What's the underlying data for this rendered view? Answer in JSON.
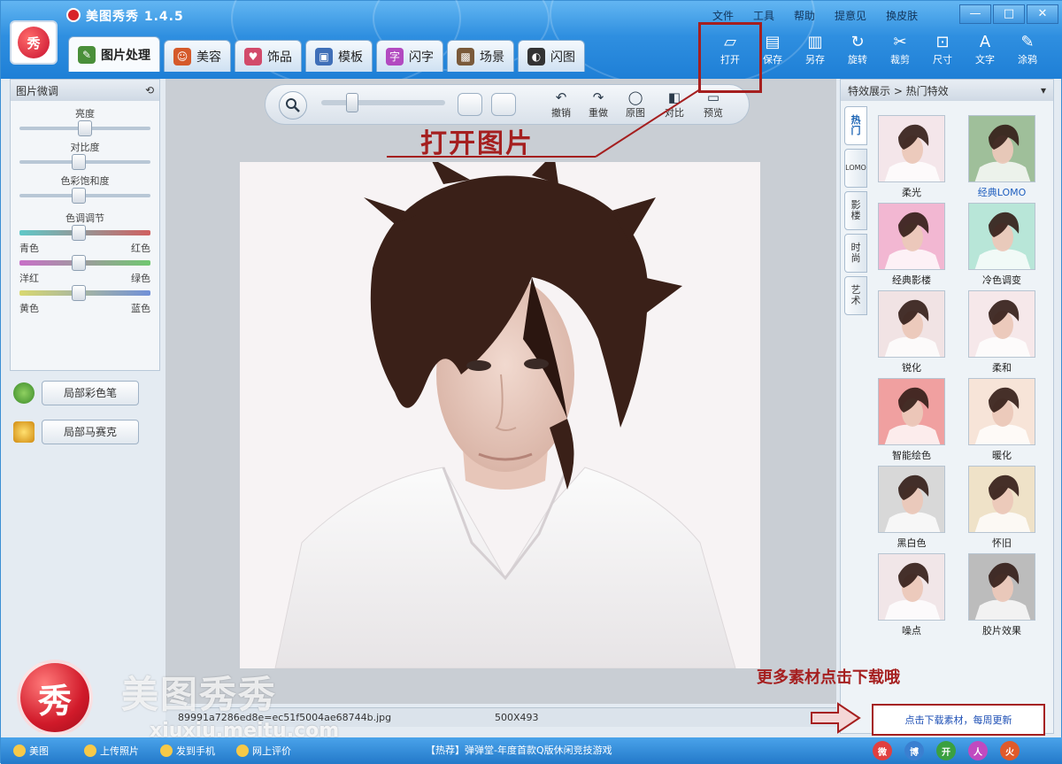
{
  "app": {
    "title": "美图秀秀 1.4.5",
    "logo_text": "秀"
  },
  "menu": [
    "文件",
    "工具",
    "帮助",
    "提意见",
    "换皮肤"
  ],
  "window_controls": [
    "—",
    "□",
    "✕"
  ],
  "tabs": [
    {
      "label": "图片处理",
      "icon": "image-edit-icon",
      "color": "#4a8f3a"
    },
    {
      "label": "美容",
      "icon": "face-icon",
      "color": "#d55a2a"
    },
    {
      "label": "饰品",
      "icon": "accessory-icon",
      "color": "#d24a6a"
    },
    {
      "label": "模板",
      "icon": "template-icon",
      "color": "#3f6fb8"
    },
    {
      "label": "闪字",
      "icon": "text-icon",
      "color": "#b24ac0"
    },
    {
      "label": "场景",
      "icon": "scene-icon",
      "color": "#7a5a3a"
    },
    {
      "label": "闪图",
      "icon": "flash-image-icon",
      "color": "#333333"
    }
  ],
  "tools": [
    {
      "label": "打开",
      "icon": "folder-open-icon",
      "glyph": "📂"
    },
    {
      "label": "保存",
      "icon": "save-icon",
      "glyph": "▤"
    },
    {
      "label": "另存",
      "icon": "save-as-icon",
      "glyph": "▥"
    },
    {
      "label": "旋转",
      "icon": "rotate-icon",
      "glyph": "↻"
    },
    {
      "label": "裁剪",
      "icon": "scissors-icon",
      "glyph": "✂"
    },
    {
      "label": "尺寸",
      "icon": "resize-icon",
      "glyph": "⊡"
    },
    {
      "label": "文字",
      "icon": "text-tool-icon",
      "glyph": "A"
    },
    {
      "label": "涂鸦",
      "icon": "brush-icon",
      "glyph": "✎"
    }
  ],
  "annotations": {
    "open_image": "打开图片",
    "more_materials": "更多素材点击下载哦",
    "download_box": "点击下载素材，每周更新"
  },
  "left_panel": {
    "title": "图片微调",
    "sliders": [
      {
        "label": "亮度",
        "value": 0.5
      },
      {
        "label": "对比度",
        "value": 0.45
      },
      {
        "label": "色彩饱和度",
        "value": 0.45
      }
    ],
    "color_adjust": {
      "title": "色调调节",
      "rows": [
        {
          "left": "青色",
          "right": "红色",
          "value": 0.45,
          "gradient": [
            "#5fc8c8",
            "#d06060"
          ]
        },
        {
          "left": "洋红",
          "right": "绿色",
          "value": 0.45,
          "gradient": [
            "#c870c8",
            "#70c870"
          ]
        },
        {
          "left": "黄色",
          "right": "蓝色",
          "value": 0.45,
          "gradient": [
            "#d8d870",
            "#7090d8"
          ]
        }
      ]
    },
    "buttons": [
      {
        "label": "局部彩色笔",
        "icon": "color-pen-icon",
        "color": "#5aa53a"
      },
      {
        "label": "局部马赛克",
        "icon": "mosaic-icon",
        "color": "#e2a22a"
      }
    ]
  },
  "canvas_toolbar": {
    "zoom_value": 0.25,
    "buttons": [
      {
        "label": "撤销",
        "icon": "undo-icon",
        "glyph": "↶"
      },
      {
        "label": "重做",
        "icon": "redo-icon",
        "glyph": "↷"
      },
      {
        "label": "原图",
        "icon": "original-icon",
        "glyph": "◯"
      },
      {
        "label": "对比",
        "icon": "compare-icon",
        "glyph": "◧"
      },
      {
        "label": "预览",
        "icon": "preview-icon",
        "glyph": "▭"
      }
    ]
  },
  "file_info": {
    "filename": "89991a7286ed8e=ec51f5004ae68744b.jpg",
    "size": "500X493"
  },
  "right_panel": {
    "title": "特效展示 > 热门特效",
    "vtabs": [
      "热门",
      "LOMO",
      "影楼",
      "时尚",
      "艺术"
    ],
    "effects": [
      {
        "label": "柔光",
        "tint": "#f4e6ea",
        "link": false
      },
      {
        "label": "经典LOMO",
        "tint": "#9fbf9a",
        "link": true
      },
      {
        "label": "经典影楼",
        "tint": "#f2b7d2",
        "link": false
      },
      {
        "label": "冷色调变",
        "tint": "#b8e6d8",
        "link": false
      },
      {
        "label": "锐化",
        "tint": "#f1e3e4",
        "link": false
      },
      {
        "label": "柔和",
        "tint": "#f6e8ea",
        "link": false
      },
      {
        "label": "智能绘色",
        "tint": "#f0a0a0",
        "link": false
      },
      {
        "label": "暖化",
        "tint": "#f7e4d8",
        "link": false
      },
      {
        "label": "黑白色",
        "tint": "#d8d8d8",
        "link": false
      },
      {
        "label": "怀旧",
        "tint": "#efe2c8",
        "link": false
      },
      {
        "label": "噪点",
        "tint": "#f1e6e8",
        "link": false
      },
      {
        "label": "胶片效果",
        "tint": "#bcbcbc",
        "link": false
      }
    ]
  },
  "status": {
    "items": [
      {
        "label": "美图",
        "icon": "home-icon"
      },
      {
        "label": "上传照片",
        "icon": "upload-icon"
      },
      {
        "label": "发到手机",
        "icon": "phone-icon"
      },
      {
        "label": "网上评价",
        "icon": "comment-icon"
      }
    ],
    "promo": "【热荐】弹弹堂-年度首款Q版休闲竞技游戏",
    "social": [
      {
        "label": "微",
        "color": "#e04040"
      },
      {
        "label": "博",
        "color": "#3a7fd0"
      },
      {
        "label": "开",
        "color": "#3aa040"
      },
      {
        "label": "人",
        "color": "#c04ac0"
      },
      {
        "label": "火",
        "color": "#e05a2a"
      }
    ]
  },
  "watermark": {
    "brand": "美图秀秀",
    "ball": "秀",
    "url": "xiuxiu.meitu.com"
  }
}
